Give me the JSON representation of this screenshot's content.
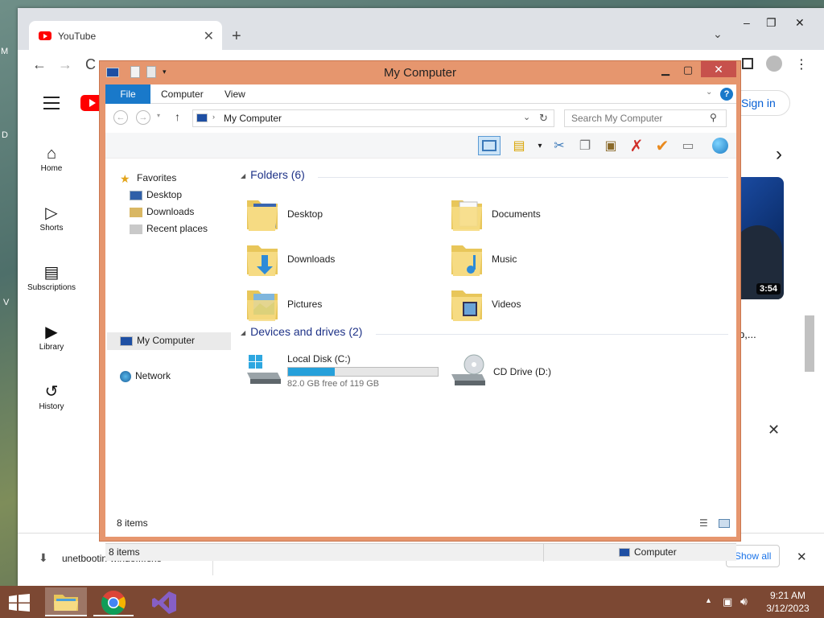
{
  "desktop": {
    "edge_texts": [
      "M",
      "D",
      "V"
    ]
  },
  "browser": {
    "tab_title": "YouTube",
    "tab_close": "✕",
    "new_tab": "+",
    "tab_menu": "⌄",
    "window_controls": {
      "minimize": "–",
      "restore": "❐",
      "close": "✕"
    },
    "back": "←",
    "forward": "→",
    "reload": "C"
  },
  "youtube": {
    "sign_in": "Sign in",
    "sidebar": [
      {
        "label": "Home",
        "icon": "home-icon"
      },
      {
        "label": "Shorts",
        "icon": "shorts-icon"
      },
      {
        "label": "Subscriptions",
        "icon": "subscriptions-icon"
      },
      {
        "label": "Library",
        "icon": "library-icon"
      },
      {
        "label": "History",
        "icon": "history-icon"
      }
    ],
    "video_duration": "3:54",
    "video_title_fragment": "p,...",
    "next_arrow": "›",
    "dismiss": "✕"
  },
  "download_bar": {
    "file_name": "unetbootin-windo....exe",
    "show_all": "Show all",
    "close": "✕"
  },
  "explorer": {
    "title": "My Computer",
    "ribbon_tabs": [
      "File",
      "Computer",
      "View"
    ],
    "help": "?",
    "address": "My Computer",
    "search_placeholder": "Search My Computer",
    "nav": {
      "favorites": "Favorites",
      "favorites_items": [
        "Desktop",
        "Downloads",
        "Recent places"
      ],
      "computer": "My Computer",
      "network": "Network"
    },
    "groups": {
      "folders": "Folders (6)",
      "devices": "Devices and drives (2)"
    },
    "folders": [
      "Desktop",
      "Documents",
      "Downloads",
      "Music",
      "Pictures",
      "Videos"
    ],
    "drives": [
      {
        "name": "Local Disk (C:)",
        "free_text": "82.0 GB free of 119 GB",
        "used_fraction": 0.311
      },
      {
        "name": "CD Drive (D:)"
      }
    ],
    "items_count": "8 items",
    "status_count": "8 items",
    "status_location": "Computer"
  },
  "taskbar": {
    "time": "9:21 AM",
    "date": "3/12/2023",
    "apps": [
      "start-icon",
      "file-explorer-icon",
      "chrome-icon",
      "visual-studio-icon"
    ]
  },
  "colors": {
    "explorer_frame": "#e6966e",
    "file_tab": "#1979ca",
    "close_button": "#c7514c",
    "taskbar": "#7c4833",
    "youtube_red": "#ff0000"
  }
}
